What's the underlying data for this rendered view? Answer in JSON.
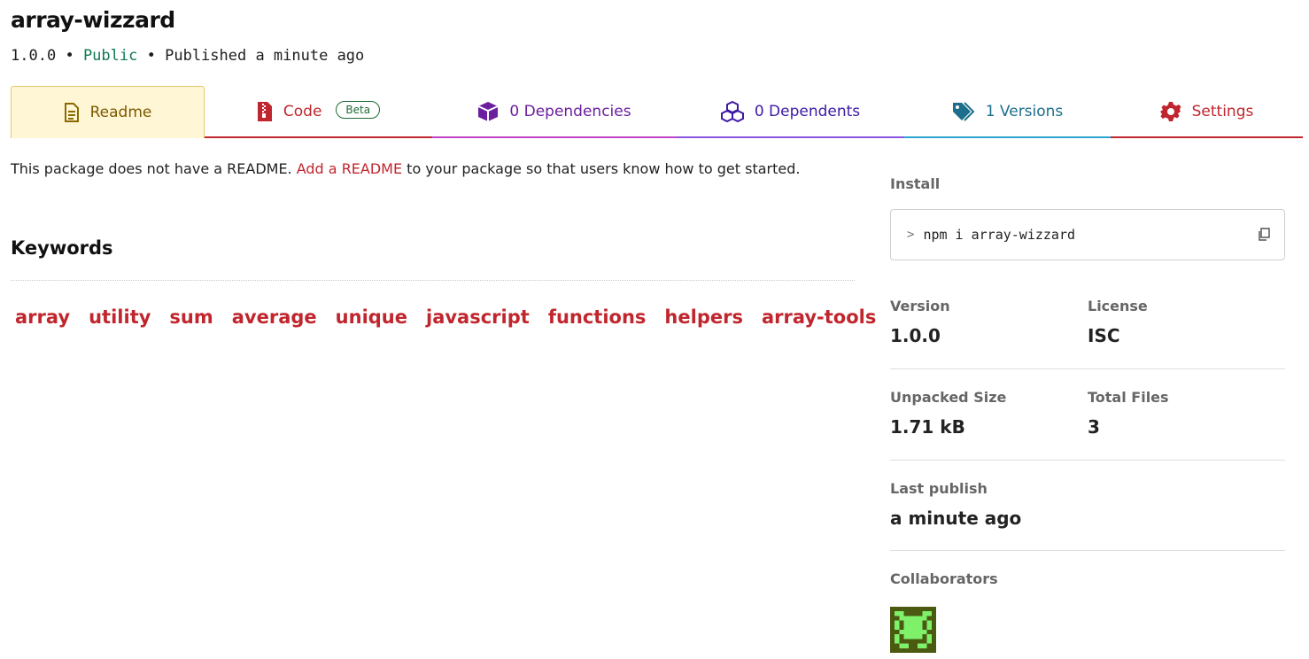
{
  "package": {
    "name": "array-wizzard",
    "version": "1.0.0",
    "separator": "•",
    "visibility": "Public",
    "published": "Published a minute ago"
  },
  "tabs": {
    "readme": "Readme",
    "code": "Code",
    "beta": "Beta",
    "dependencies": "0 Dependencies",
    "dependents": "0 Dependents",
    "versions": "1 Versions",
    "settings": "Settings"
  },
  "readme_note": {
    "before": "This package does not have a README. ",
    "link": "Add a README",
    "after": " to your package so that users know how to get started."
  },
  "keywords": {
    "title": "Keywords",
    "items": [
      "array",
      "utility",
      "sum",
      "average",
      "unique",
      "javascript",
      "functions",
      "helpers",
      "array-tools"
    ]
  },
  "sidebar": {
    "install_label": "Install",
    "install_prompt": ">",
    "install_command": "npm i array-wizzard",
    "version_label": "Version",
    "version_value": "1.0.0",
    "license_label": "License",
    "license_value": "ISC",
    "unpacked_label": "Unpacked Size",
    "unpacked_value": "1.71 kB",
    "files_label": "Total Files",
    "files_value": "3",
    "last_publish_label": "Last publish",
    "last_publish_value": "a minute ago",
    "collaborators_label": "Collaborators"
  },
  "icons": {
    "readme": "document-icon",
    "code": "zip-file-icon",
    "dependencies": "box-icon",
    "dependents": "boxes-icon",
    "versions": "tags-icon",
    "settings": "gear-icon",
    "copy": "copy-icon",
    "avatar": "identicon-avatar"
  },
  "colors": {
    "accent_red": "#c0262d",
    "public_green": "#0f7a52",
    "readme_tab_bg": "#fff6d5",
    "avatar_green": "#7ef06a",
    "avatar_dark": "#4a5a10"
  }
}
